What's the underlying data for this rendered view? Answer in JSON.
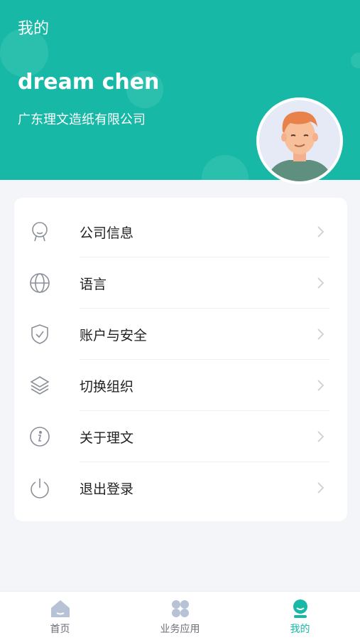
{
  "header": {
    "title": "我的",
    "user_name": "dream chen",
    "company": "广东理文造纸有限公司"
  },
  "menu": {
    "items": [
      {
        "label": "公司信息",
        "icon": "badge-icon"
      },
      {
        "label": "语言",
        "icon": "globe-icon"
      },
      {
        "label": "账户与安全",
        "icon": "shield-icon"
      },
      {
        "label": "切换组织",
        "icon": "layers-icon"
      },
      {
        "label": "关于理文",
        "icon": "info-icon"
      },
      {
        "label": "退出登录",
        "icon": "power-icon"
      }
    ]
  },
  "tabbar": {
    "tabs": [
      {
        "label": "首页",
        "icon": "home-icon"
      },
      {
        "label": "业务应用",
        "icon": "apps-icon"
      },
      {
        "label": "我的",
        "icon": "profile-icon",
        "active": true
      }
    ]
  },
  "colors": {
    "brand": "#17b9a6",
    "inactive_icon": "#b8c2d6",
    "text": "#222222"
  }
}
